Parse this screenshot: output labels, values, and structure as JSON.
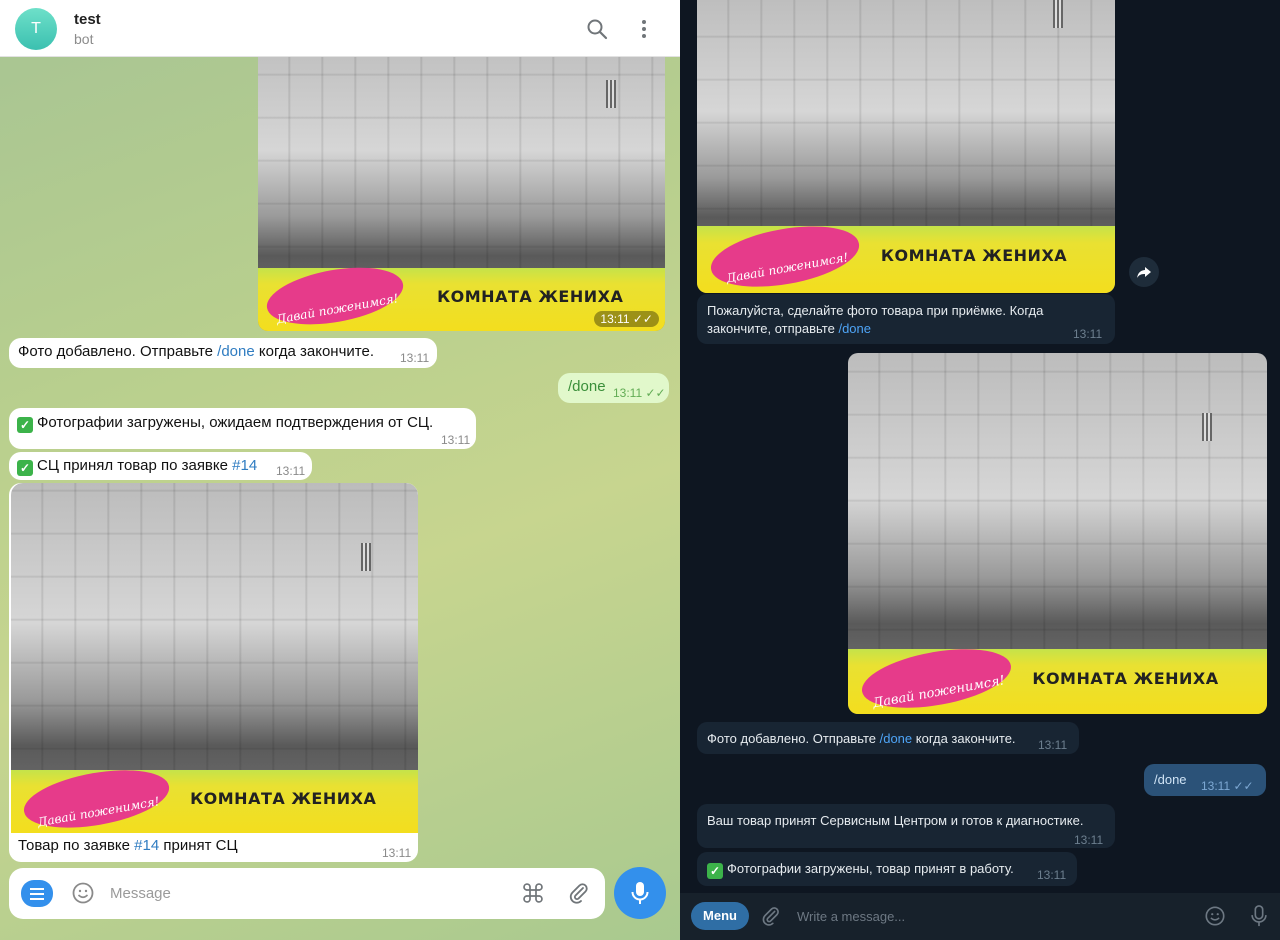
{
  "left": {
    "header": {
      "avatar_letter": "T",
      "title": "test",
      "subtitle": "bot"
    },
    "photo1": {
      "banner_logo": "Давай поженимся!",
      "banner_text": "КОМНАТА ЖЕНИХА",
      "time": "13:11"
    },
    "msg_photo_added": {
      "text_pre": "Фото добавлено. Отправьте ",
      "link": "/done",
      "text_post": " когда закончите.",
      "time": "13:11"
    },
    "msg_done": {
      "text": "/done",
      "time": "13:11"
    },
    "msg_photos_uploaded": {
      "text": "Фотографии загружены, ожидаем подтверждения от СЦ.",
      "time": "13:11"
    },
    "msg_accepted": {
      "text_pre": "СЦ принял товар по заявке ",
      "link": "#14",
      "time": "13:11"
    },
    "photo2": {
      "banner_logo": "Давай поженимся!",
      "banner_text": "КОМНАТА ЖЕНИХА",
      "caption_pre": "Товар по заявке ",
      "caption_link": "#14",
      "caption_post": " принят СЦ",
      "time": "13:11"
    },
    "composer": {
      "placeholder": "Message"
    }
  },
  "right": {
    "photo1": {
      "banner_logo": "Давай поженимся!",
      "banner_text": "КОМНАТА ЖЕНИХА"
    },
    "msg_please": {
      "text_pre": "Пожалуйста, сделайте фото товара при приёмке. Когда закончите, отправьте ",
      "link": "/done",
      "time": "13:11"
    },
    "photo2": {
      "banner_logo": "Давай поженимся!",
      "banner_text": "КОМНАТА ЖЕНИХА"
    },
    "msg_photo_added": {
      "text_pre": "Фото добавлено. Отправьте ",
      "link": "/done",
      "text_post": " когда закончите.",
      "time": "13:11"
    },
    "msg_done": {
      "text": "/done",
      "time": "13:11"
    },
    "msg_accepted": {
      "text": "Ваш товар принят Сервисным Центром и готов к диагностике.",
      "time": "13:11"
    },
    "msg_uploaded": {
      "text": "Фотографии загружены, товар принят в работу.",
      "time": "13:11"
    },
    "input": {
      "menu_label": "Menu",
      "placeholder": "Write a message..."
    }
  }
}
